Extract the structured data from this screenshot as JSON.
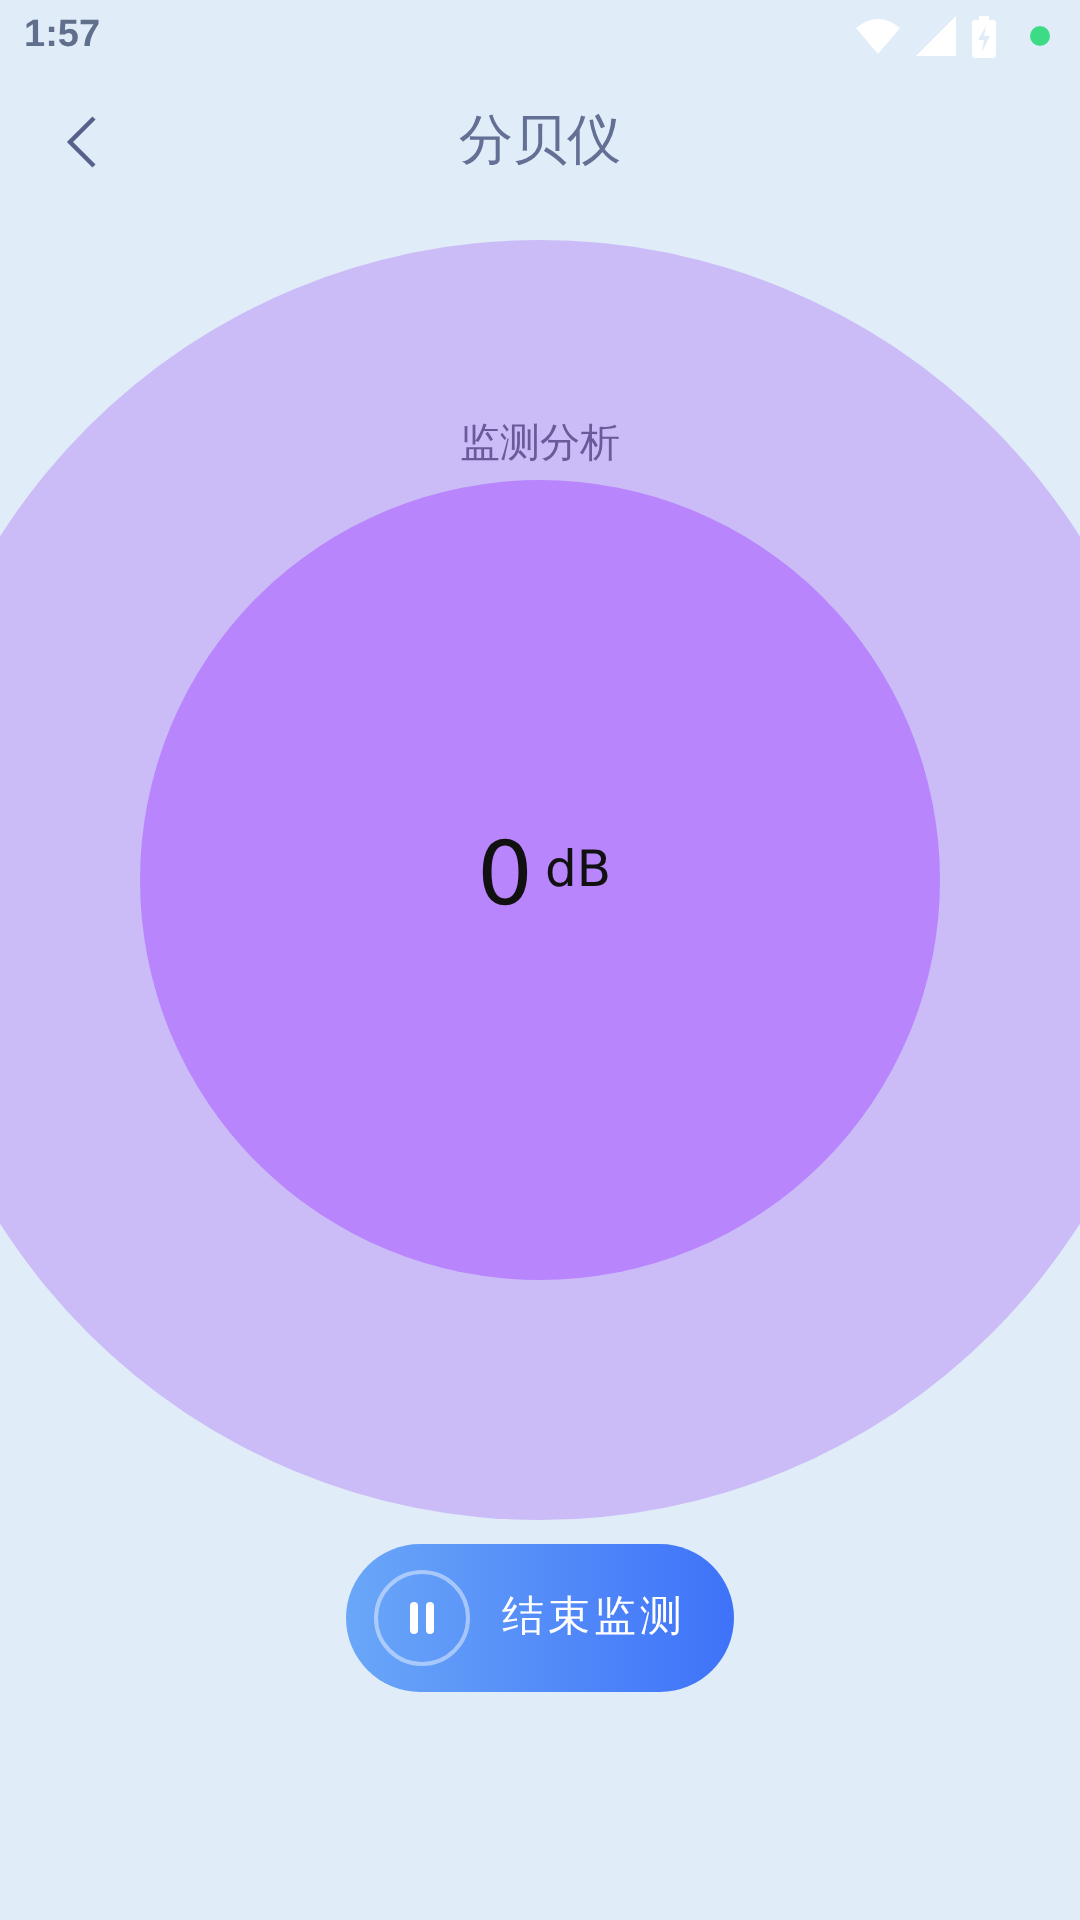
{
  "status_bar": {
    "time": "1:57"
  },
  "header": {
    "title": "分贝仪"
  },
  "meter": {
    "label": "监测分析",
    "value": "0",
    "unit": "dB"
  },
  "action_button": {
    "label": "结束监测",
    "paused": false
  }
}
